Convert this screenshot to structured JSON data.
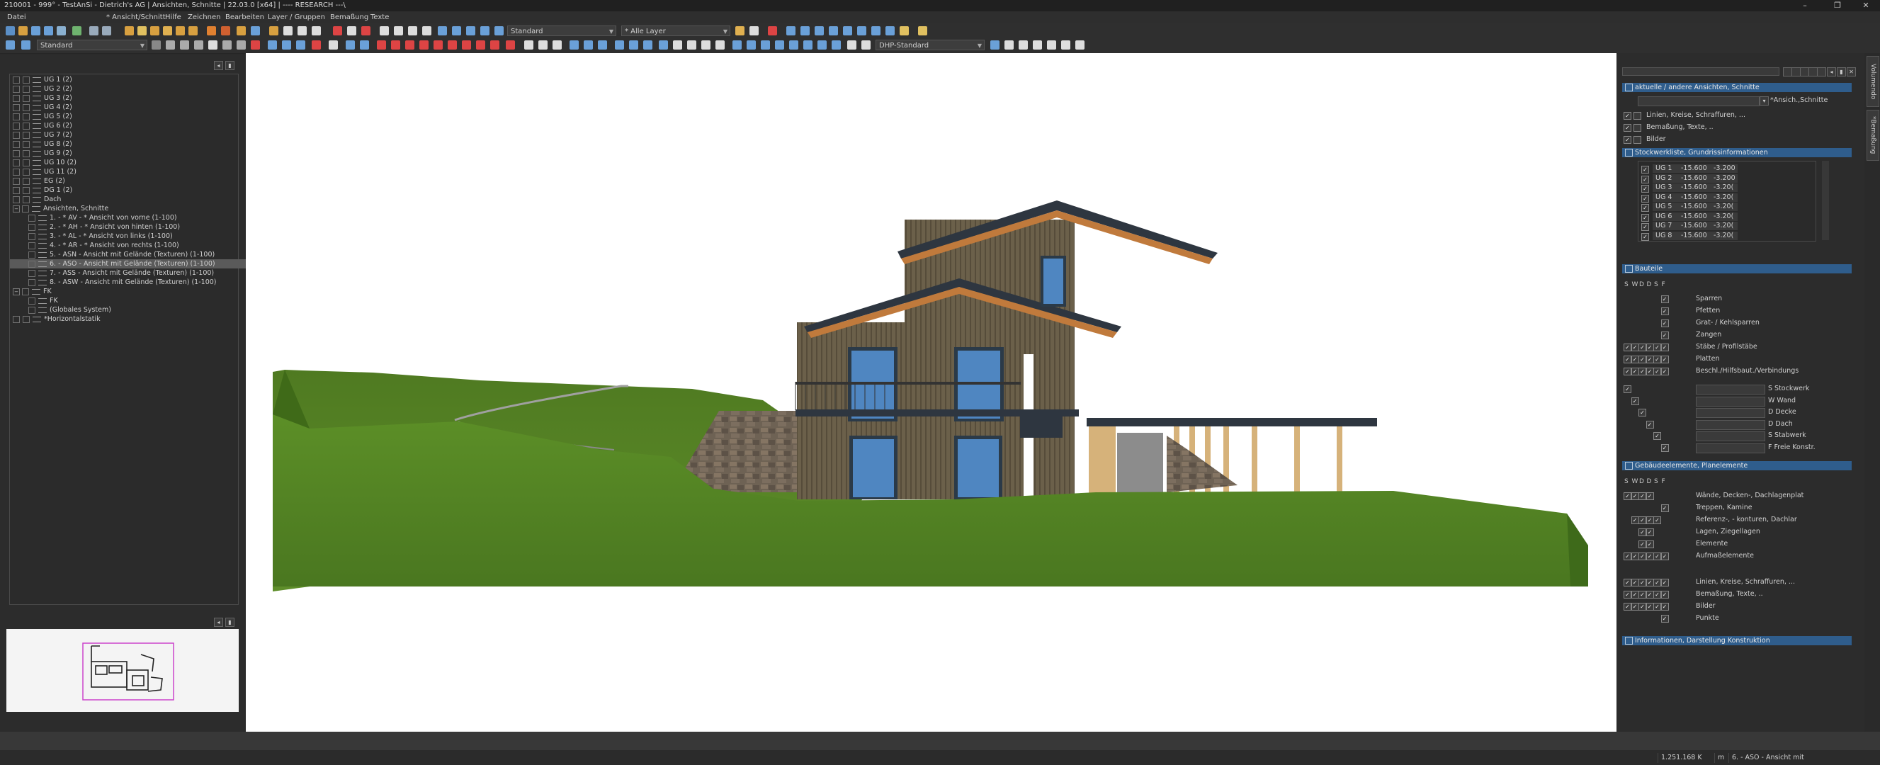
{
  "window": {
    "title": "210001 - 999° - TestAnSi - Dietrich's AG | Ansichten, Schnitte | 22.03.0 [x64] | ---- RESEARCH ---\\",
    "minimize": "–",
    "maximize": "❐",
    "close": "✕"
  },
  "menu": [
    {
      "label": "Datei"
    },
    {
      "label": "* Ansicht/Schnitt"
    },
    {
      "label": "Hilfe"
    },
    {
      "label": "Zeichnen"
    },
    {
      "label": "Bearbeiten"
    },
    {
      "label": "Layer / Gruppen"
    },
    {
      "label": "Bemaßung"
    },
    {
      "label": "Texte"
    }
  ],
  "toolbar1": {
    "combo_standard": "Standard",
    "combo_layer": "* Alle Layer"
  },
  "toolbar2": {
    "combo_standard": "Standard",
    "combo_dhp": "DHP-Standard"
  },
  "tree": {
    "items": [
      {
        "label": "UG 1 (2)",
        "depth": 0
      },
      {
        "label": "UG 2 (2)",
        "depth": 0
      },
      {
        "label": "UG 3 (2)",
        "depth": 0
      },
      {
        "label": "UG 4 (2)",
        "depth": 0
      },
      {
        "label": "UG 5 (2)",
        "depth": 0
      },
      {
        "label": "UG 6 (2)",
        "depth": 0
      },
      {
        "label": "UG 7 (2)",
        "depth": 0
      },
      {
        "label": "UG 8 (2)",
        "depth": 0
      },
      {
        "label": "UG 9 (2)",
        "depth": 0
      },
      {
        "label": "UG 10 (2)",
        "depth": 0
      },
      {
        "label": "UG 11 (2)",
        "depth": 0
      },
      {
        "label": "EG (2)",
        "depth": 0
      },
      {
        "label": "DG 1 (2)",
        "depth": 0
      },
      {
        "label": "Dach",
        "depth": 0
      },
      {
        "label": "Ansichten, Schnitte",
        "depth": 0,
        "expanded": true
      },
      {
        "label": "1. - * AV - * Ansicht von vorne (1-100)",
        "depth": 1
      },
      {
        "label": "2. - * AH - * Ansicht von hinten (1-100)",
        "depth": 1
      },
      {
        "label": "3. - * AL - * Ansicht von links (1-100)",
        "depth": 1
      },
      {
        "label": "4. - * AR - * Ansicht von rechts (1-100)",
        "depth": 1
      },
      {
        "label": "5. - ASN - Ansicht mit Gelände (Texturen) (1-100)",
        "depth": 1
      },
      {
        "label": "6. - ASO - Ansicht mit Gelände (Texturen) (1-100)",
        "depth": 1,
        "selected": true
      },
      {
        "label": "7. - ASS - Ansicht mit Gelände (Texturen) (1-100)",
        "depth": 1
      },
      {
        "label": "8. - ASW - Ansicht mit Gelände (Texturen) (1-100)",
        "depth": 1
      },
      {
        "label": "FK",
        "depth": 0,
        "expanded": true
      },
      {
        "label": "FK",
        "depth": 1
      },
      {
        "label": "(Globales System)",
        "depth": 1
      },
      {
        "label": "*Horizontalstatik",
        "depth": 0
      }
    ]
  },
  "right": {
    "sect_views": "aktuelle / andere Ansichten, Schnitte",
    "current_view": "*Ansich.,Schnitte",
    "view_opts": [
      "Linien, Kreise, Schraffuren, ...",
      "Bemaßung, Texte, ..",
      "Bilder"
    ],
    "sect_floors": "Stockwerkliste, Grundrissinformationen",
    "floors": [
      {
        "name": "UG 1",
        "a": "-15.600",
        "b": "-3.200"
      },
      {
        "name": "UG 2",
        "a": "-15.600",
        "b": "-3.200"
      },
      {
        "name": "UG 3",
        "a": "-15.600",
        "b": "-3.20("
      },
      {
        "name": "UG 4",
        "a": "-15.600",
        "b": "-3.20("
      },
      {
        "name": "UG 5",
        "a": "-15.600",
        "b": "-3.20("
      },
      {
        "name": "UG 6",
        "a": "-15.600",
        "b": "-3.20("
      },
      {
        "name": "UG 7",
        "a": "-15.600",
        "b": "-3.20("
      },
      {
        "name": "UG 8",
        "a": "-15.600",
        "b": "-3.20("
      }
    ],
    "sect_parts": "Bauteile",
    "cols": [
      "S",
      "W",
      "D",
      "D",
      "S",
      "F"
    ],
    "parts": [
      "Sparren",
      "Pfetten",
      "Grat- / Kehlsparren",
      "Zangen",
      "Stäbe / Profilstäbe",
      "Platten",
      "Beschl./Hilfsbaut./Verbindungs"
    ],
    "parts_fields": [
      "S Stockwerk",
      "W Wand",
      "D Decke",
      "D Dach",
      "S Stabwerk",
      "F Freie Konstr."
    ],
    "sect_elements": "Gebäudeelemente, Planelemente",
    "elements": [
      "Wände, Decken-, Dachlagenplat",
      "Treppen, Kamine",
      "Referenz-, - konturen, Dachlar",
      "Lagen, Ziegellagen",
      "Elemente",
      "Aufmaßelemente"
    ],
    "elements2": [
      "Linien, Kreise, Schraffuren, ...",
      "Bemaßung, Texte, ..",
      "Bilder",
      "Punkte"
    ],
    "sect_info": "Informationen, Darstellung Konstruktion"
  },
  "sidetabs": [
    "Volumendo",
    "*Bemaßung"
  ],
  "status": {
    "size": "1.251.168 K",
    "unit": "m",
    "view": "6. - ASO - Ansicht mit"
  }
}
